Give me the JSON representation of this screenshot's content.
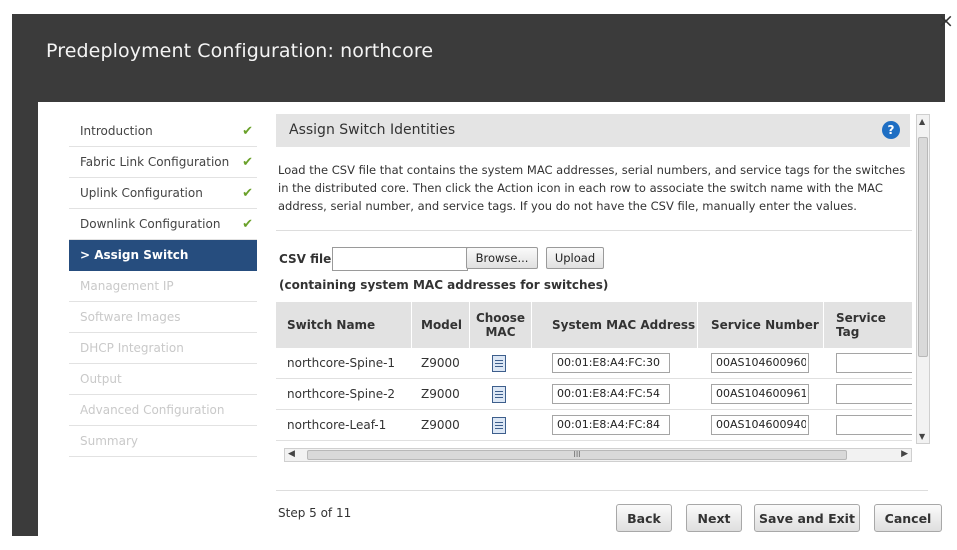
{
  "dialog": {
    "title": "Predeployment Configuration: northcore",
    "close_label": "×"
  },
  "sidebar": {
    "items": [
      {
        "label": "Introduction",
        "state": "completed"
      },
      {
        "label": "Fabric Link Configuration",
        "state": "completed"
      },
      {
        "label": "Uplink Configuration",
        "state": "completed"
      },
      {
        "label": "Downlink Configuration",
        "state": "completed"
      },
      {
        "label": "> Assign Switch Identities",
        "state": "active"
      },
      {
        "label": "Management IP",
        "state": "disabled"
      },
      {
        "label": "Software Images",
        "state": "disabled"
      },
      {
        "label": "DHCP Integration",
        "state": "disabled"
      },
      {
        "label": "Output",
        "state": "disabled"
      },
      {
        "label": "Advanced Configuration",
        "state": "disabled"
      },
      {
        "label": "Summary",
        "state": "disabled"
      }
    ],
    "check_glyph": "✔"
  },
  "panel": {
    "title": "Assign Switch Identities",
    "help_label": "?",
    "description": "Load the CSV file that contains the system MAC addresses, serial numbers, and service tags for the switches in the distributed core. Then click the Action icon in each row to associate the switch name with the MAC address, serial number, and service tags. If you do not have the CSV file, manually enter the values."
  },
  "csv": {
    "label": "CSV file",
    "value": "",
    "browse_label": "Browse...",
    "upload_label": "Upload",
    "note": "(containing system MAC addresses for switches)"
  },
  "table": {
    "columns": [
      "Switch Name",
      "Model",
      "Choose MAC",
      "System MAC Address",
      "Service Number",
      "Service Tag"
    ],
    "rows": [
      {
        "switch_name": "northcore-Spine-1",
        "model": "Z9000",
        "mac": "00:01:E8:A4:FC:30",
        "service_number": "00AS104600960",
        "service_tag": ""
      },
      {
        "switch_name": "northcore-Spine-2",
        "model": "Z9000",
        "mac": "00:01:E8:A4:FC:54",
        "service_number": "00AS104600961",
        "service_tag": ""
      },
      {
        "switch_name": "northcore-Leaf-1",
        "model": "Z9000",
        "mac": "00:01:E8:A4:FC:84",
        "service_number": "00AS104600940",
        "service_tag": ""
      }
    ]
  },
  "scrollbar": {
    "thumb_grip": "III",
    "left_arrow": "◀",
    "right_arrow": "▶",
    "up_arrow": "▲",
    "down_arrow": "▼"
  },
  "footer": {
    "step_text": "Step 5 of 11",
    "back_label": "Back",
    "next_label": "Next",
    "save_exit_label": "Save and Exit",
    "cancel_label": "Cancel"
  },
  "colors": {
    "accent": "#264d7e",
    "check": "#6aa12a",
    "help": "#1e6ec3"
  }
}
